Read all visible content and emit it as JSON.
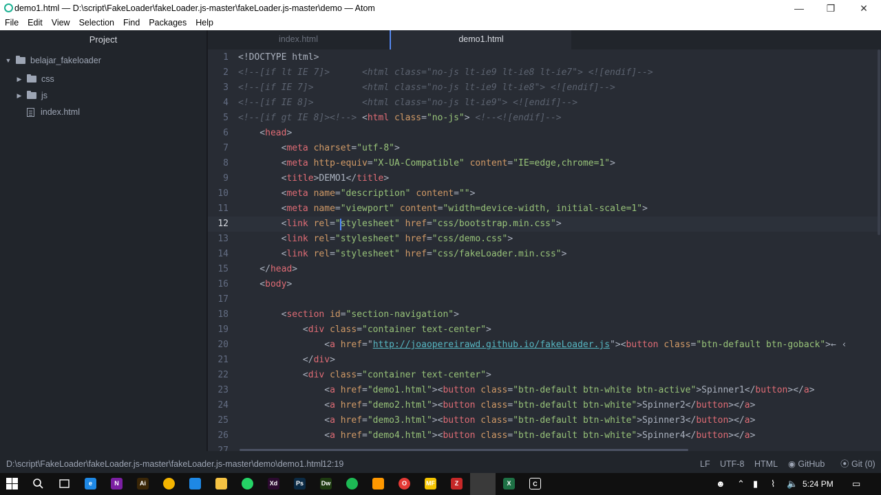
{
  "window": {
    "title": "demo1.html — D:\\script\\FakeLoader\\fakeLoader.js-master\\fakeLoader.js-master\\demo — Atom",
    "minimize_icon": "minimize-icon",
    "maximize_icon": "maximize-icon",
    "close_icon": "close-icon"
  },
  "menu": [
    "File",
    "Edit",
    "View",
    "Selection",
    "Find",
    "Packages",
    "Help"
  ],
  "sidebar": {
    "title": "Project",
    "root": "belajar_fakeloader",
    "items": [
      {
        "label": "css",
        "type": "folder"
      },
      {
        "label": "js",
        "type": "folder"
      },
      {
        "label": "index.html",
        "type": "file"
      }
    ]
  },
  "tabs": [
    {
      "label": "index.html",
      "active": false
    },
    {
      "label": "demo1.html",
      "active": true
    }
  ],
  "editor": {
    "line_numbers": [
      "1",
      "2",
      "3",
      "4",
      "5",
      "6",
      "7",
      "8",
      "9",
      "10",
      "11",
      "12",
      "13",
      "14",
      "15",
      "16",
      "17",
      "18",
      "19",
      "20",
      "21",
      "22",
      "23",
      "24",
      "25",
      "26",
      "27"
    ],
    "current_line": "12",
    "lines": [
      [
        [
          "pn",
          "<!DOCTYPE html>"
        ]
      ],
      [
        [
          "cm",
          "<!--[if lt IE 7]>      <html class=\"no-js lt-ie9 lt-ie8 lt-ie7\"> <![endif]-->"
        ]
      ],
      [
        [
          "cm",
          "<!--[if IE 7]>         <html class=\"no-js lt-ie9 lt-ie8\"> <![endif]-->"
        ]
      ],
      [
        [
          "cm",
          "<!--[if IE 8]>         <html class=\"no-js lt-ie9\"> <![endif]-->"
        ]
      ],
      [
        [
          "cm",
          "<!--[if gt IE 8]><!--> "
        ],
        [
          "pn",
          "<"
        ],
        [
          "tg",
          "html"
        ],
        [
          "pn",
          " "
        ],
        [
          "at",
          "class"
        ],
        [
          "pn",
          "="
        ],
        [
          "st",
          "\"no-js\""
        ],
        [
          "pn",
          "> "
        ],
        [
          "cm",
          "<!--<![endif]-->"
        ]
      ],
      [
        [
          "pn",
          "    <"
        ],
        [
          "tg",
          "head"
        ],
        [
          "pn",
          ">"
        ]
      ],
      [
        [
          "pn",
          "        <"
        ],
        [
          "tg",
          "meta"
        ],
        [
          "pn",
          " "
        ],
        [
          "at",
          "charset"
        ],
        [
          "pn",
          "="
        ],
        [
          "st",
          "\"utf-8\""
        ],
        [
          "pn",
          ">"
        ]
      ],
      [
        [
          "pn",
          "        <"
        ],
        [
          "tg",
          "meta"
        ],
        [
          "pn",
          " "
        ],
        [
          "at",
          "http-equiv"
        ],
        [
          "pn",
          "="
        ],
        [
          "st",
          "\"X-UA-Compatible\""
        ],
        [
          "pn",
          " "
        ],
        [
          "at",
          "content"
        ],
        [
          "pn",
          "="
        ],
        [
          "st",
          "\"IE=edge,chrome=1\""
        ],
        [
          "pn",
          ">"
        ]
      ],
      [
        [
          "pn",
          "        <"
        ],
        [
          "tg",
          "title"
        ],
        [
          "pn",
          ">DEMO1</"
        ],
        [
          "tg",
          "title"
        ],
        [
          "pn",
          ">"
        ]
      ],
      [
        [
          "pn",
          "        <"
        ],
        [
          "tg",
          "meta"
        ],
        [
          "pn",
          " "
        ],
        [
          "at",
          "name"
        ],
        [
          "pn",
          "="
        ],
        [
          "st",
          "\"description\""
        ],
        [
          "pn",
          " "
        ],
        [
          "at",
          "content"
        ],
        [
          "pn",
          "="
        ],
        [
          "st",
          "\"\""
        ],
        [
          "pn",
          ">"
        ]
      ],
      [
        [
          "pn",
          "        <"
        ],
        [
          "tg",
          "meta"
        ],
        [
          "pn",
          " "
        ],
        [
          "at",
          "name"
        ],
        [
          "pn",
          "="
        ],
        [
          "st",
          "\"viewport\""
        ],
        [
          "pn",
          " "
        ],
        [
          "at",
          "content"
        ],
        [
          "pn",
          "="
        ],
        [
          "st",
          "\"width=device-width, initial-scale=1\""
        ],
        [
          "pn",
          ">"
        ]
      ],
      [
        [
          "pn",
          "        <"
        ],
        [
          "tg",
          "link"
        ],
        [
          "pn",
          " "
        ],
        [
          "at",
          "rel"
        ],
        [
          "pn",
          "="
        ],
        [
          "st",
          "\"stylesheet\""
        ],
        [
          "pn",
          " "
        ],
        [
          "at",
          "href"
        ],
        [
          "pn",
          "="
        ],
        [
          "st",
          "\"css/bootstrap.min.css\""
        ],
        [
          "pn",
          ">"
        ]
      ],
      [
        [
          "pn",
          "        <"
        ],
        [
          "tg",
          "link"
        ],
        [
          "pn",
          " "
        ],
        [
          "at",
          "rel"
        ],
        [
          "pn",
          "="
        ],
        [
          "st",
          "\"stylesheet\""
        ],
        [
          "pn",
          " "
        ],
        [
          "at",
          "href"
        ],
        [
          "pn",
          "="
        ],
        [
          "st",
          "\"css/demo.css\""
        ],
        [
          "pn",
          ">"
        ]
      ],
      [
        [
          "pn",
          "        <"
        ],
        [
          "tg",
          "link"
        ],
        [
          "pn",
          " "
        ],
        [
          "at",
          "rel"
        ],
        [
          "pn",
          "="
        ],
        [
          "st",
          "\"stylesheet\""
        ],
        [
          "pn",
          " "
        ],
        [
          "at",
          "href"
        ],
        [
          "pn",
          "="
        ],
        [
          "st",
          "\"css/fakeLoader.min.css\""
        ],
        [
          "pn",
          ">"
        ]
      ],
      [
        [
          "pn",
          "    </"
        ],
        [
          "tg",
          "head"
        ],
        [
          "pn",
          ">"
        ]
      ],
      [
        [
          "pn",
          "    <"
        ],
        [
          "tg",
          "body"
        ],
        [
          "pn",
          ">"
        ]
      ],
      [
        [
          "pn",
          ""
        ]
      ],
      [
        [
          "pn",
          "        <"
        ],
        [
          "tg",
          "section"
        ],
        [
          "pn",
          " "
        ],
        [
          "at",
          "id"
        ],
        [
          "pn",
          "="
        ],
        [
          "st",
          "\"section-navigation\""
        ],
        [
          "pn",
          ">"
        ]
      ],
      [
        [
          "pn",
          "            <"
        ],
        [
          "tg",
          "div"
        ],
        [
          "pn",
          " "
        ],
        [
          "at",
          "class"
        ],
        [
          "pn",
          "="
        ],
        [
          "st",
          "\"container text-center\""
        ],
        [
          "pn",
          ">"
        ]
      ],
      [
        [
          "pn",
          "                <"
        ],
        [
          "tg",
          "a"
        ],
        [
          "pn",
          " "
        ],
        [
          "at",
          "href"
        ],
        [
          "pn",
          "=\""
        ],
        [
          "ln",
          "http://joaopereirawd.github.io/fakeLoader.js"
        ],
        [
          "pn",
          "\"><"
        ],
        [
          "tg",
          "button"
        ],
        [
          "pn",
          " "
        ],
        [
          "at",
          "class"
        ],
        [
          "pn",
          "="
        ],
        [
          "st",
          "\"btn-default btn-goback\""
        ],
        [
          "pn",
          ">← ‹"
        ]
      ],
      [
        [
          "pn",
          "            </"
        ],
        [
          "tg",
          "div"
        ],
        [
          "pn",
          ">"
        ]
      ],
      [
        [
          "pn",
          "            <"
        ],
        [
          "tg",
          "div"
        ],
        [
          "pn",
          " "
        ],
        [
          "at",
          "class"
        ],
        [
          "pn",
          "="
        ],
        [
          "st",
          "\"container text-center\""
        ],
        [
          "pn",
          ">"
        ]
      ],
      [
        [
          "pn",
          "                <"
        ],
        [
          "tg",
          "a"
        ],
        [
          "pn",
          " "
        ],
        [
          "at",
          "href"
        ],
        [
          "pn",
          "="
        ],
        [
          "st",
          "\"demo1.html\""
        ],
        [
          "pn",
          "><"
        ],
        [
          "tg",
          "button"
        ],
        [
          "pn",
          " "
        ],
        [
          "at",
          "class"
        ],
        [
          "pn",
          "="
        ],
        [
          "st",
          "\"btn-default btn-white btn-active\""
        ],
        [
          "pn",
          ">Spinner1</"
        ],
        [
          "tg",
          "button"
        ],
        [
          "pn",
          "></"
        ],
        [
          "tg",
          "a"
        ],
        [
          "pn",
          ">"
        ]
      ],
      [
        [
          "pn",
          "                <"
        ],
        [
          "tg",
          "a"
        ],
        [
          "pn",
          " "
        ],
        [
          "at",
          "href"
        ],
        [
          "pn",
          "="
        ],
        [
          "st",
          "\"demo2.html\""
        ],
        [
          "pn",
          "><"
        ],
        [
          "tg",
          "button"
        ],
        [
          "pn",
          " "
        ],
        [
          "at",
          "class"
        ],
        [
          "pn",
          "="
        ],
        [
          "st",
          "\"btn-default btn-white\""
        ],
        [
          "pn",
          ">Spinner2</"
        ],
        [
          "tg",
          "button"
        ],
        [
          "pn",
          "></"
        ],
        [
          "tg",
          "a"
        ],
        [
          "pn",
          ">"
        ]
      ],
      [
        [
          "pn",
          "                <"
        ],
        [
          "tg",
          "a"
        ],
        [
          "pn",
          " "
        ],
        [
          "at",
          "href"
        ],
        [
          "pn",
          "="
        ],
        [
          "st",
          "\"demo3.html\""
        ],
        [
          "pn",
          "><"
        ],
        [
          "tg",
          "button"
        ],
        [
          "pn",
          " "
        ],
        [
          "at",
          "class"
        ],
        [
          "pn",
          "="
        ],
        [
          "st",
          "\"btn-default btn-white\""
        ],
        [
          "pn",
          ">Spinner3</"
        ],
        [
          "tg",
          "button"
        ],
        [
          "pn",
          "></"
        ],
        [
          "tg",
          "a"
        ],
        [
          "pn",
          ">"
        ]
      ],
      [
        [
          "pn",
          "                <"
        ],
        [
          "tg",
          "a"
        ],
        [
          "pn",
          " "
        ],
        [
          "at",
          "href"
        ],
        [
          "pn",
          "="
        ],
        [
          "st",
          "\"demo4.html\""
        ],
        [
          "pn",
          "><"
        ],
        [
          "tg",
          "button"
        ],
        [
          "pn",
          " "
        ],
        [
          "at",
          "class"
        ],
        [
          "pn",
          "="
        ],
        [
          "st",
          "\"btn-default btn-white\""
        ],
        [
          "pn",
          ">Spinner4</"
        ],
        [
          "tg",
          "button"
        ],
        [
          "pn",
          "></"
        ],
        [
          "tg",
          "a"
        ],
        [
          "pn",
          ">"
        ]
      ]
    ]
  },
  "status": {
    "path": "D:\\script\\FakeLoader\\fakeLoader.js-master\\fakeLoader.js-master\\demo\\demo1.html",
    "cursor": "12:19",
    "line_ending": "LF",
    "encoding": "UTF-8",
    "grammar": "HTML",
    "github": "GitHub",
    "git": "Git (0)"
  },
  "taskbar": {
    "apps": [
      {
        "icon": "start-icon",
        "color": "#ffffff",
        "label": ""
      },
      {
        "icon": "search-icon",
        "color": "#ffffff",
        "label": ""
      },
      {
        "icon": "task-view-icon",
        "color": "#ffffff",
        "label": ""
      },
      {
        "icon": "edge-icon",
        "color": "#1e88e5",
        "label": "e"
      },
      {
        "icon": "onenote-icon",
        "color": "#7b1fa2",
        "label": "N"
      },
      {
        "icon": "illustrator-icon",
        "color": "#3a2607",
        "label": "Ai"
      },
      {
        "icon": "chrome-icon",
        "color": "#f4b400",
        "label": ""
      },
      {
        "icon": "vscode-icon",
        "color": "#1e88e5",
        "label": ""
      },
      {
        "icon": "explorer-icon",
        "color": "#f6c343",
        "label": ""
      },
      {
        "icon": "whatsapp-icon",
        "color": "#25d366",
        "label": ""
      },
      {
        "icon": "xd-icon",
        "color": "#2b0a2f",
        "label": "Xd"
      },
      {
        "icon": "photoshop-icon",
        "color": "#0b2a44",
        "label": "Ps"
      },
      {
        "icon": "dreamweaver-icon",
        "color": "#1e3b11",
        "label": "Dw"
      },
      {
        "icon": "spotify-icon",
        "color": "#1db954",
        "label": ""
      },
      {
        "icon": "sublime-icon",
        "color": "#ff9800",
        "label": ""
      },
      {
        "icon": "opera-icon",
        "color": "#e53935",
        "label": "O"
      },
      {
        "icon": "mf-icon",
        "color": "#f5c400",
        "label": "MF"
      },
      {
        "icon": "filezilla-icon",
        "color": "#c62828",
        "label": "Z"
      },
      {
        "icon": "atom-icon",
        "color": "#4caf50",
        "label": ""
      },
      {
        "icon": "excel-icon",
        "color": "#1e7145",
        "label": "X"
      },
      {
        "icon": "terminal-icon",
        "color": "#ffffff",
        "label": "C"
      }
    ],
    "time": "5:24 PM"
  }
}
